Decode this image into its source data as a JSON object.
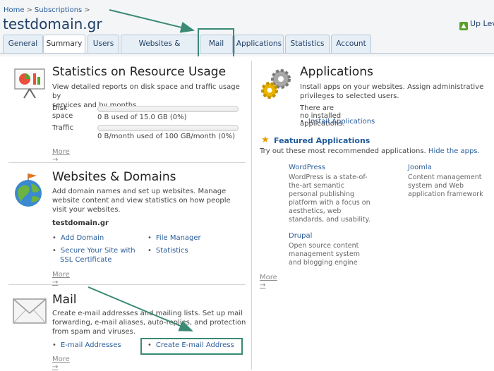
{
  "breadcrumb": {
    "home": "Home",
    "sep": ">",
    "subscriptions": "Subscriptions",
    "sep2": ">"
  },
  "title": "testdomain.gr",
  "up_level": {
    "icon": "up-arrow-icon",
    "label": "Up Level"
  },
  "tabs": [
    "General",
    "Summary",
    "Users",
    "Websites & Domains",
    "Mail",
    "Applications",
    "Statistics",
    "Account"
  ],
  "stats": {
    "title": "Statistics on Resource Usage",
    "desc_lines": [
      "View detailed reports on disk space and traffic usage by",
      "services and by months."
    ],
    "disk_label": "Disk space",
    "disk_value": "0 B used of 15.0 GB (0%)",
    "disk_fraction": 0,
    "traffic_label": "Traffic",
    "traffic_value": "0 B/month used of 100 GB/month (0%)",
    "traffic_fraction": 0,
    "more": "More →"
  },
  "websites": {
    "title": "Websites & Domains",
    "desc_lines": [
      "Add domain names and set up websites. Manage",
      "website content and view statistics on how people",
      "visit your websites."
    ],
    "domain": "testdomain.gr",
    "links_left": [
      "Add Domain",
      "Secure Your Site with",
      "SSL Certificate"
    ],
    "links_right": [
      "File Manager",
      "Statistics"
    ],
    "bullet": "•",
    "more": "More →"
  },
  "mail": {
    "title": "Mail",
    "desc_lines": [
      "Create e-mail addresses and mailing lists. Set up mail",
      "forwarding, e-mail aliases, auto-replies, and protection",
      "from spam and viruses."
    ],
    "link_left": "E-mail Addresses",
    "link_right": "Create E-mail Address",
    "more": "More →"
  },
  "applications": {
    "title": "Applications",
    "desc_lines": [
      "Install apps on your websites. Assign administrative",
      "privileges to selected users."
    ],
    "none": "There are no installed applications.",
    "install": "Install Applications",
    "featured_title": "Featured Applications",
    "featured_desc": "Try out these most recommended applications.",
    "hide": "Hide the apps.",
    "apps": [
      {
        "name": "WordPress",
        "desc_lines": [
          "WordPress is a state-of-",
          "the-art semantic",
          "personal publishing",
          "platform with a focus on",
          "aesthetics, web",
          "standards, and usability."
        ]
      },
      {
        "name": "Joomla",
        "desc_lines": [
          "Content management",
          "system and Web",
          "application framework"
        ]
      },
      {
        "name": "Drupal",
        "desc_lines": [
          "Open source content",
          "management system",
          "and blogging engine"
        ]
      }
    ],
    "more": "More →"
  },
  "colors": {
    "accent": "#1f3f66",
    "link": "#2a5d9a",
    "highlight": "#3a8a74"
  }
}
